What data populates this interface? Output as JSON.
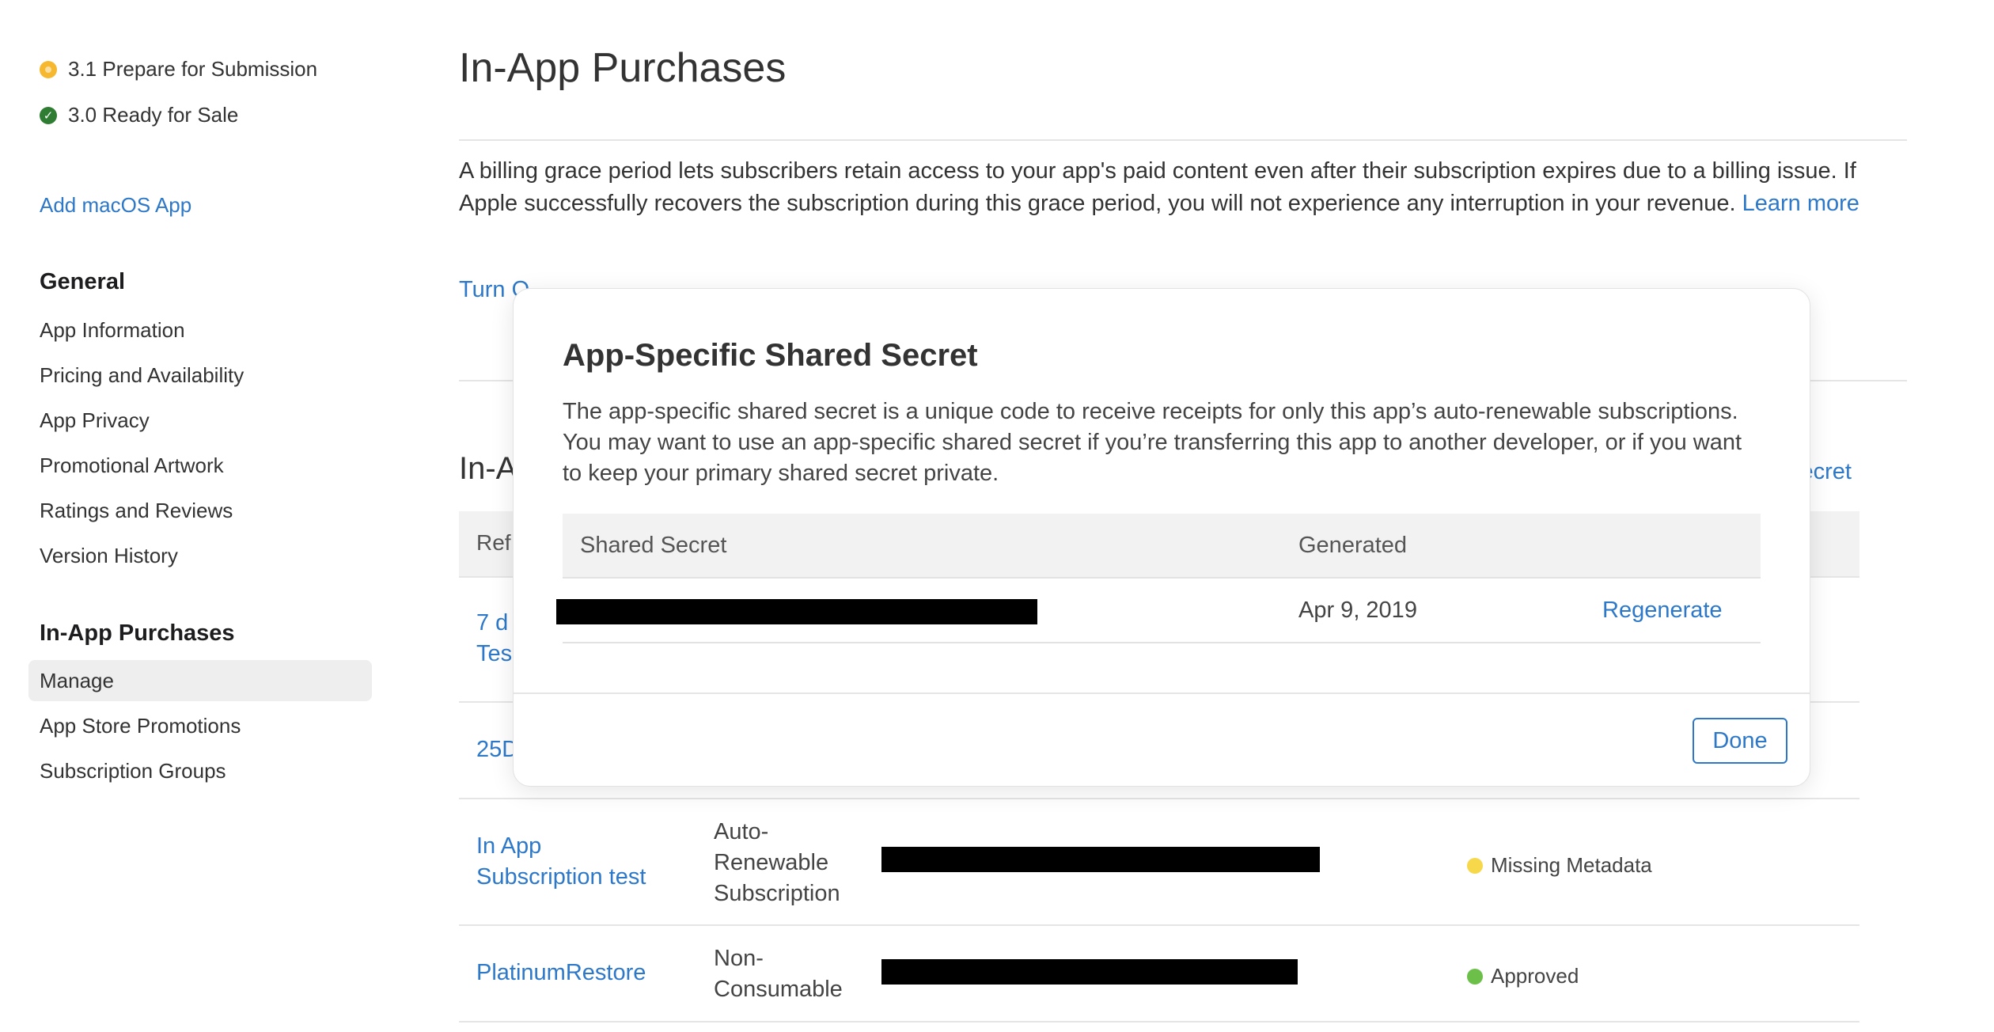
{
  "sidebar": {
    "versions": [
      {
        "label": "3.1 Prepare for Submission",
        "status_color": "#f5b82e"
      },
      {
        "label": "3.0 Ready for Sale",
        "status_color": "#2e7d32"
      }
    ],
    "add_app_link": "Add macOS App",
    "general_heading": "General",
    "general_items": [
      "App Information",
      "Pricing and Availability",
      "App Privacy",
      "Promotional Artwork",
      "Ratings and Reviews",
      "Version History"
    ],
    "iap_heading": "In-App Purchases",
    "iap_items": [
      "Manage",
      "App Store Promotions",
      "Subscription Groups"
    ],
    "active_item": "Manage"
  },
  "main": {
    "title": "In-App Purchases",
    "grace_text": "A billing grace period lets subscribers retain access to your app's paid content even after their subscription expires due to a billing issue. If Apple successfully recovers the subscription during this grace period, you will not experience any interruption in your revenue.",
    "learn_more": "Learn more",
    "turn_on_partial": "Turn O",
    "section_title_partial": "In-A",
    "secret_link_partial": "ecret",
    "table_header_partial": "Ref",
    "rows": [
      {
        "name_line1_partial": "7 d",
        "name_line2_partial": "Tes"
      },
      {
        "name_partial": "25D"
      },
      {
        "name_line1": "In App",
        "name_line2": "Subscription test",
        "type_line1": "Auto-",
        "type_line2": "Renewable",
        "type_line3": "Subscription",
        "status": "Missing Metadata",
        "status_color": "#f7d84a"
      },
      {
        "name": "PlatinumRestore",
        "type_line1": "Non-",
        "type_line2": "Consumable",
        "status": "Approved",
        "status_color": "#6cc04a"
      }
    ]
  },
  "modal": {
    "title": "App-Specific Shared Secret",
    "description": "The app-specific shared secret is a unique code to receive receipts for only this app’s auto-renewable subscriptions. You may want to use an app-specific shared secret if you’re transferring this app to another developer, or if you want to keep your primary shared secret private.",
    "col_secret": "Shared Secret",
    "col_generated": "Generated",
    "generated_date": "Apr 9, 2019",
    "regenerate": "Regenerate",
    "done": "Done"
  }
}
